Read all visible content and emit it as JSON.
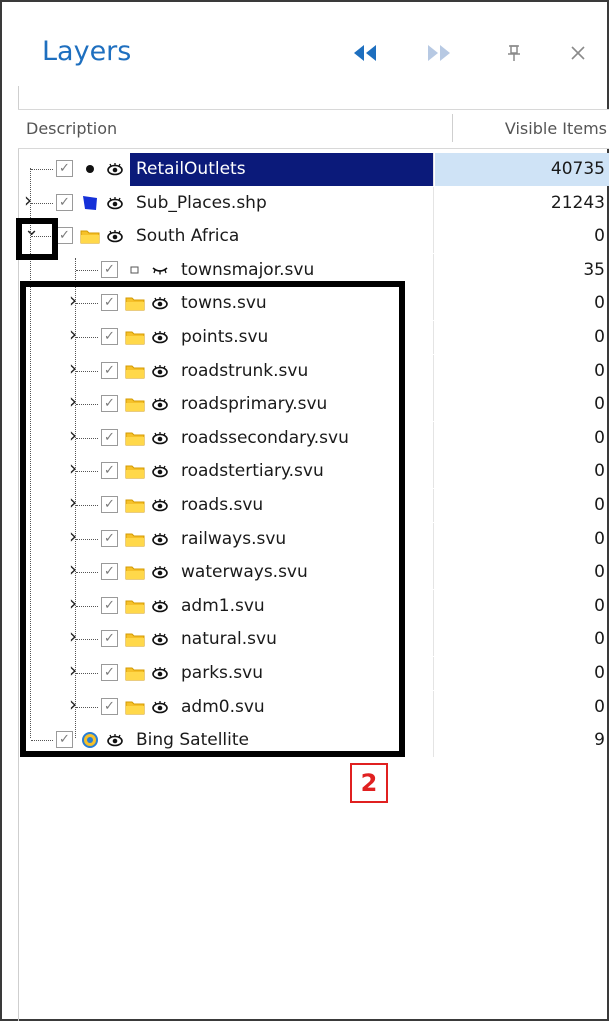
{
  "panel": {
    "title": "Layers",
    "buttons": {
      "collapse_icon": "double-left-arrow",
      "expand_icon": "double-right-arrow",
      "pin_icon": "pin",
      "close_icon": "close"
    }
  },
  "columns": {
    "description": "Description",
    "visible_items": "Visible Items"
  },
  "rows": [
    {
      "name": "RetailOutlets",
      "count": "40735",
      "icon": "point",
      "expander": false,
      "level": 0,
      "selected": true
    },
    {
      "name": "Sub_Places.shp",
      "count": "21243",
      "icon": "polygon",
      "expander": true,
      "level": 0,
      "selected": false
    },
    {
      "name": "South Africa",
      "count": "0",
      "icon": "folder",
      "expander": true,
      "expanded": true,
      "level": 0,
      "selected": false
    },
    {
      "name": "townsmajor.svu",
      "count": "35",
      "icon": "small-square",
      "expander": false,
      "level": 1,
      "selected": false
    },
    {
      "name": "towns.svu",
      "count": "0",
      "icon": "folder",
      "expander": true,
      "level": 1,
      "selected": false
    },
    {
      "name": "points.svu",
      "count": "0",
      "icon": "folder",
      "expander": true,
      "level": 1,
      "selected": false
    },
    {
      "name": "roadstrunk.svu",
      "count": "0",
      "icon": "folder",
      "expander": true,
      "level": 1,
      "selected": false
    },
    {
      "name": "roadsprimary.svu",
      "count": "0",
      "icon": "folder",
      "expander": true,
      "level": 1,
      "selected": false
    },
    {
      "name": "roadssecondary.svu",
      "count": "0",
      "icon": "folder",
      "expander": true,
      "level": 1,
      "selected": false
    },
    {
      "name": "roadstertiary.svu",
      "count": "0",
      "icon": "folder",
      "expander": true,
      "level": 1,
      "selected": false
    },
    {
      "name": "roads.svu",
      "count": "0",
      "icon": "folder",
      "expander": true,
      "level": 1,
      "selected": false
    },
    {
      "name": "railways.svu",
      "count": "0",
      "icon": "folder",
      "expander": true,
      "level": 1,
      "selected": false
    },
    {
      "name": "waterways.svu",
      "count": "0",
      "icon": "folder",
      "expander": true,
      "level": 1,
      "selected": false
    },
    {
      "name": "adm1.svu",
      "count": "0",
      "icon": "folder",
      "expander": true,
      "level": 1,
      "selected": false
    },
    {
      "name": "natural.svu",
      "count": "0",
      "icon": "folder",
      "expander": true,
      "level": 1,
      "selected": false
    },
    {
      "name": "parks.svu",
      "count": "0",
      "icon": "folder",
      "expander": true,
      "level": 1,
      "selected": false
    },
    {
      "name": "adm0.svu",
      "count": "0",
      "icon": "folder",
      "expander": true,
      "level": 1,
      "selected": false
    },
    {
      "name": "Bing Satellite",
      "count": "9",
      "icon": "globe",
      "expander": false,
      "level": 0,
      "selected": false
    }
  ],
  "annotation": {
    "label": "2",
    "color": "#e02020"
  },
  "colors": {
    "accent": "#1e6fbf",
    "selected_bg": "#0b1a7a",
    "selected_count_bg": "#cfe3f6",
    "folder": "#e8a400"
  }
}
